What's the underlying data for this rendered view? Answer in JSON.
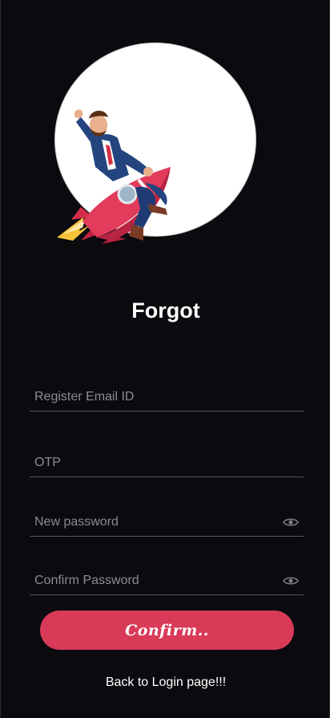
{
  "page": {
    "title": "Forgot"
  },
  "form": {
    "email": {
      "placeholder": "Register Email ID",
      "value": ""
    },
    "otp": {
      "placeholder": "OTP",
      "value": ""
    },
    "new_password": {
      "placeholder": "New password",
      "value": "",
      "icon": "eye-icon"
    },
    "confirm_password": {
      "placeholder": "Confirm Password",
      "value": "",
      "icon": "eye-icon"
    },
    "confirm_label": "Confirm.."
  },
  "back_link": "Back to Login page!!!",
  "colors": {
    "background": "#0b0a0f",
    "accent": "#d83a58",
    "underline": "#55545c",
    "placeholder": "#8c8b93"
  },
  "illustration": {
    "icon": "businessman-on-rocket-illustration"
  }
}
